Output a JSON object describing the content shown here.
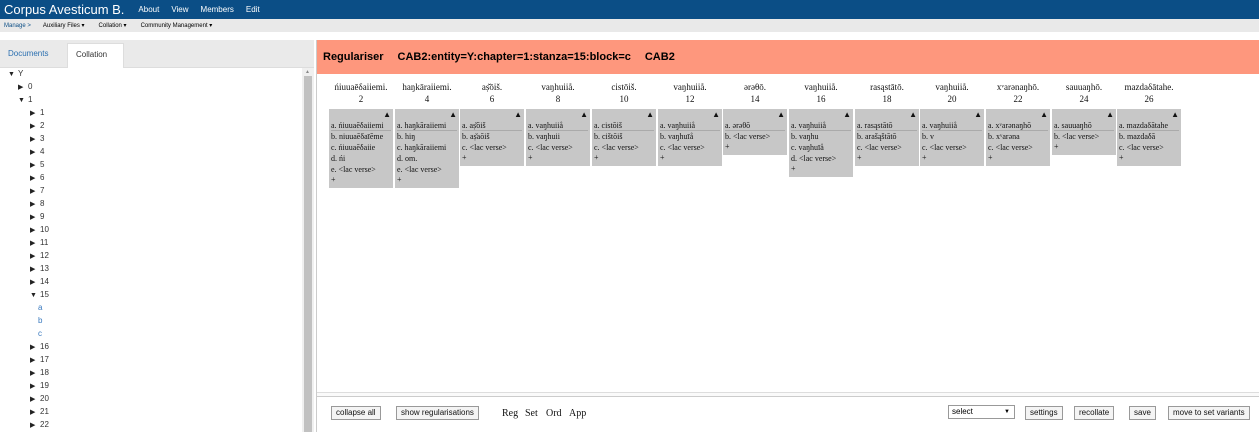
{
  "topbar": {
    "brand": "Corpus Avesticum B.",
    "nav": [
      "About",
      "View",
      "Members",
      "Edit"
    ]
  },
  "subbar": {
    "crumb": "Manage >",
    "menus": [
      "Auxiliary Files ▾",
      "Collation ▾",
      "Community Management ▾"
    ]
  },
  "tabs": [
    "Documents",
    "Collation"
  ],
  "tree": {
    "root": "Y",
    "level1": [
      "0",
      "1"
    ],
    "chapters_before": [
      "1",
      "2",
      "3",
      "4",
      "5",
      "6",
      "7",
      "8",
      "9",
      "10",
      "11",
      "12",
      "13",
      "14"
    ],
    "open_chapter": "15",
    "blocks": [
      "a",
      "b",
      "c"
    ],
    "chapters_after": [
      "16",
      "17",
      "18",
      "19",
      "20",
      "21",
      "22"
    ]
  },
  "header": {
    "title": "Regulariser",
    "context": "CAB2:entity=Y:chapter=1:stanza=15:block=c",
    "witness": "CAB2"
  },
  "columns": [
    {
      "word": "ńiuuaēδaiiemi.",
      "num": "2",
      "readings": [
        "a. ńiuuaēδaiiemi",
        "b. niuuaēδaīēme",
        "c. ńiuuaēδaiie",
        "d. ńi",
        "e. <lac verse>"
      ]
    },
    {
      "word": "haŋkāraiiemi.",
      "num": "4",
      "readings": [
        "a. haŋkāraiiemi",
        "b. hiŋ",
        "c. haŋkāraiiemi",
        "d. om.",
        "e. <lac verse>"
      ]
    },
    {
      "word": "aṣ̌ōiš.",
      "num": "6",
      "readings": [
        "a. aṣ̌ōiš",
        "b. aṣ̌aōiš",
        "c. <lac verse>"
      ]
    },
    {
      "word": "vaŋhuiiå.",
      "num": "8",
      "readings": [
        "a. vaŋhuiiå",
        "b. vaŋhuii",
        "c. <lac verse>"
      ]
    },
    {
      "word": "cistōiš.",
      "num": "10",
      "readings": [
        "a. cistōiš",
        "b. cištōiš",
        "c. <lac verse>"
      ]
    },
    {
      "word": "vaŋhuiiå.",
      "num": "12",
      "readings": [
        "a. vaŋhuiiå",
        "b. vaŋhuīå",
        "c. <lac verse>"
      ]
    },
    {
      "word": "ərəθō.",
      "num": "14",
      "readings": [
        "a. ərəθō",
        "b. <lac verse>"
      ]
    },
    {
      "word": "vaŋhuiiå.",
      "num": "16",
      "readings": [
        "a. vaŋhuiiå",
        "b. vaŋhu",
        "c. vaŋhuīå",
        "d. <lac verse>"
      ]
    },
    {
      "word": "rasąstātō.",
      "num": "18",
      "readings": [
        "a. rasąstātō",
        "b. arašąštātō",
        "c. <lac verse>"
      ]
    },
    {
      "word": "vaŋhuiiå.",
      "num": "20",
      "readings": [
        "a. vaŋhuiiå",
        "b. v",
        "c. <lac verse>"
      ]
    },
    {
      "word": "xᵛarənaŋhō.",
      "num": "22",
      "readings": [
        "a. xᵛarənaŋhō",
        "b. xᵛarəna",
        "c. <lac verse>"
      ]
    },
    {
      "word": "sauuaŋhō.",
      "num": "24",
      "readings": [
        "a. sauuaŋhō",
        "b. <lac verse>"
      ]
    },
    {
      "word": "mazdaδātahe.",
      "num": "26",
      "readings": [
        "a. mazdaδātahe",
        "b. mazdaδā",
        "c. <lac verse>"
      ]
    }
  ],
  "icons": {
    "expand": "triangle-up-icon",
    "add": "+"
  },
  "footer": {
    "collapse_all": "collapse all",
    "show_regularisations": "show regularisations",
    "text_links": [
      "Reg",
      "Set",
      "Ord",
      "App"
    ],
    "select_value": "select",
    "settings": "settings",
    "recollate": "recollate",
    "save": "save",
    "move": "move to set variants"
  },
  "colors": {
    "topbar": "#0b4e86",
    "header": "#fe977d",
    "reading_box": "#c7c7c7"
  }
}
